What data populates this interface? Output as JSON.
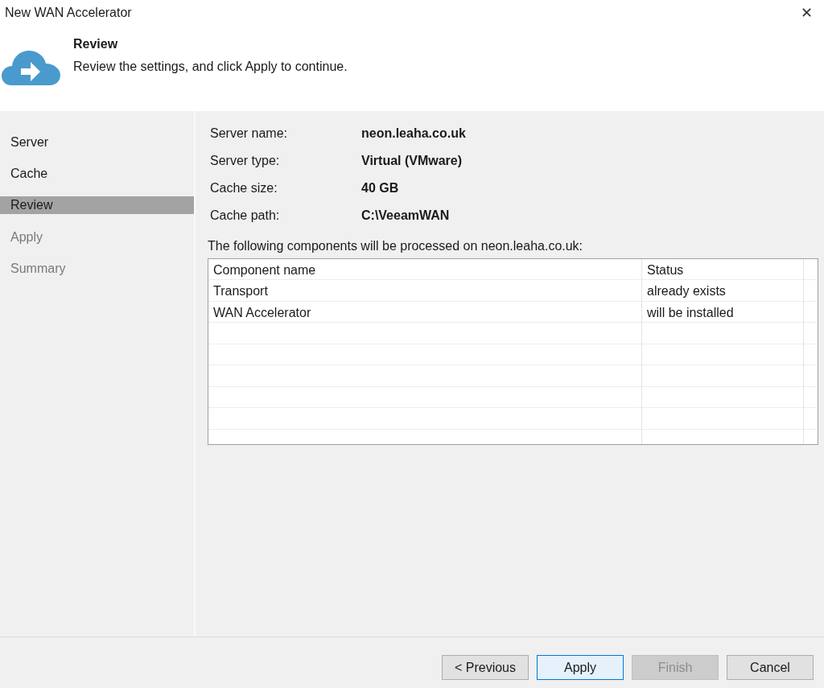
{
  "window": {
    "title": "New WAN Accelerator",
    "close_symbol": "✕"
  },
  "header": {
    "title": "Review",
    "subtitle": "Review the settings, and click Apply to continue."
  },
  "steps": [
    {
      "label": "Server",
      "selected": false,
      "disabled": false
    },
    {
      "label": "Cache",
      "selected": false,
      "disabled": false
    },
    {
      "label": "Review",
      "selected": true,
      "disabled": false
    },
    {
      "label": "Apply",
      "selected": false,
      "disabled": true
    },
    {
      "label": "Summary",
      "selected": false,
      "disabled": true
    }
  ],
  "properties": [
    {
      "label": "Server name:",
      "value": "neon.leaha.co.uk"
    },
    {
      "label": "Server type:",
      "value": "Virtual (VMware)"
    },
    {
      "label": "Cache size:",
      "value": "40 GB"
    },
    {
      "label": "Cache path:",
      "value": "C:\\VeeamWAN"
    }
  ],
  "components_caption": "The following components will be processed on neon.leaha.co.uk:",
  "table": {
    "columns": [
      "Component name",
      "Status"
    ],
    "rows": [
      [
        "Transport",
        "already exists"
      ],
      [
        "WAN Accelerator",
        "will be installed"
      ]
    ]
  },
  "buttons": [
    {
      "label": "< Previous",
      "default": false,
      "disabled": false
    },
    {
      "label": "Apply",
      "default": true,
      "disabled": false
    },
    {
      "label": "Finish",
      "default": false,
      "disabled": true
    },
    {
      "label": "Cancel",
      "default": false,
      "disabled": false
    }
  ]
}
